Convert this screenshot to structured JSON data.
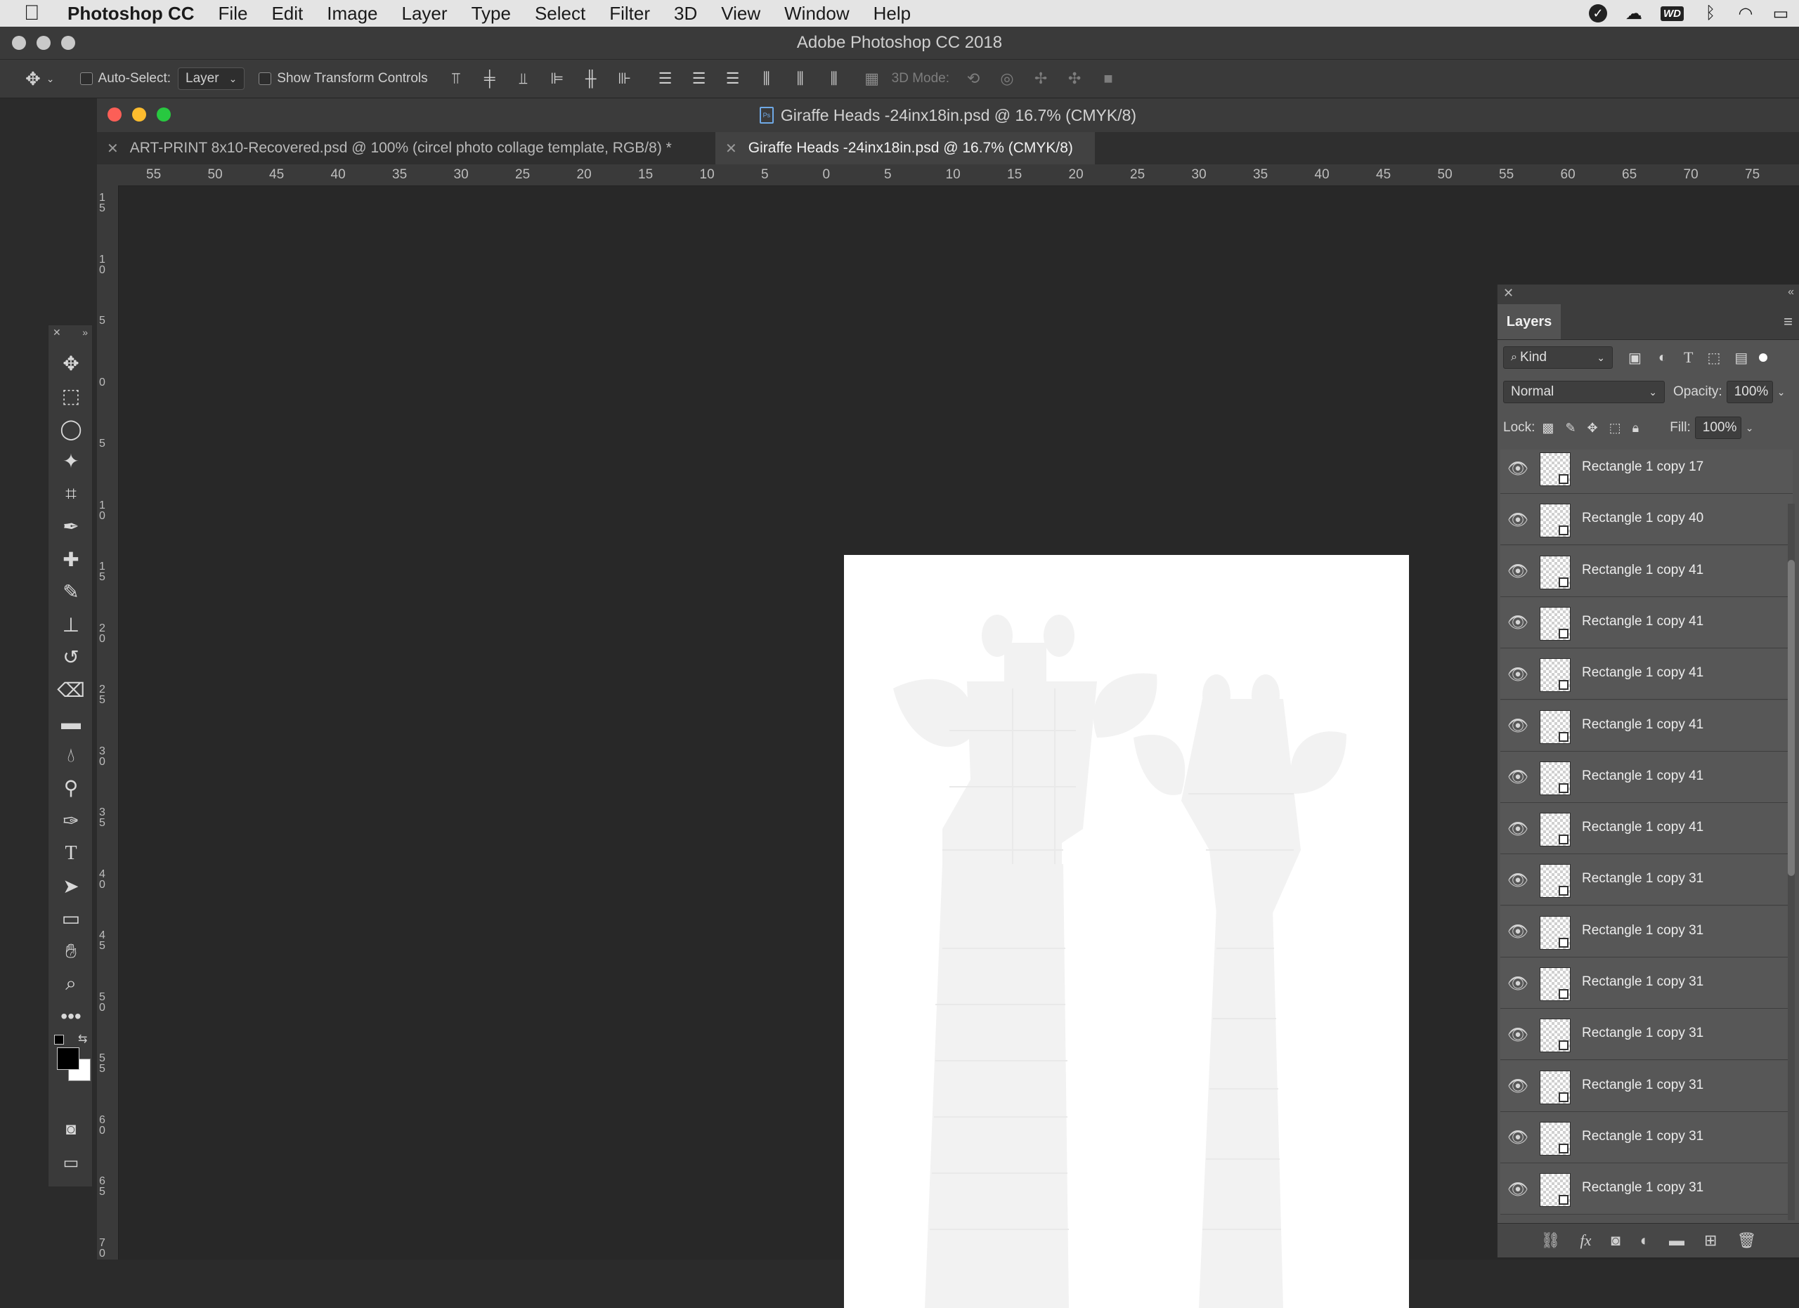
{
  "menubar": {
    "app_name": "Photoshop CC",
    "items": [
      "File",
      "Edit",
      "Image",
      "Layer",
      "Type",
      "Select",
      "Filter",
      "3D",
      "View",
      "Window",
      "Help"
    ],
    "status_icons": [
      "checkmark-icon",
      "creative-cloud-icon",
      "wd-icon",
      "bluetooth-icon",
      "wifi-icon",
      "battery-icon"
    ],
    "wd_label": "WD"
  },
  "app": {
    "title": "Adobe Photoshop CC 2018"
  },
  "options_bar": {
    "auto_select_label": "Auto-Select:",
    "auto_select_value": "Layer",
    "transform_label": "Show Transform Controls",
    "mode_3d_label": "3D Mode:"
  },
  "document": {
    "title": "Giraffe Heads -24inx18in.psd @ 16.7% (CMYK/8)",
    "tabs": [
      {
        "label": "ART-PRINT 8x10-Recovered.psd @ 100% (circel photo collage template, RGB/8) *",
        "active": false
      },
      {
        "label": "Giraffe Heads -24inx18in.psd @ 16.7% (CMYK/8)",
        "active": true
      }
    ],
    "ruler_top": [
      "55",
      "50",
      "45",
      "40",
      "35",
      "30",
      "25",
      "20",
      "15",
      "10",
      "5",
      "0",
      "5",
      "10",
      "15",
      "20",
      "25",
      "30",
      "35",
      "40",
      "45",
      "50",
      "55",
      "60",
      "65",
      "70",
      "75"
    ],
    "ruler_left": [
      "15",
      "10",
      "5",
      "0",
      "5",
      "10",
      "15",
      "20",
      "25",
      "30",
      "35",
      "40",
      "45",
      "50",
      "55",
      "60",
      "65",
      "70"
    ]
  },
  "tools": [
    "move-tool",
    "marquee-tool",
    "lasso-tool",
    "magic-wand-tool",
    "crop-tool",
    "eyedropper-tool",
    "healing-brush-tool",
    "brush-tool",
    "clone-stamp-tool",
    "history-brush-tool",
    "eraser-tool",
    "gradient-tool",
    "blur-tool",
    "dodge-tool",
    "pen-tool",
    "type-tool",
    "path-selection-tool",
    "rectangle-tool",
    "hand-tool",
    "zoom-tool",
    "more-tools"
  ],
  "layers_panel": {
    "title": "Layers",
    "filter_kind": "Kind",
    "blend_mode": "Normal",
    "opacity_label": "Opacity:",
    "opacity_value": "100%",
    "lock_label": "Lock:",
    "fill_label": "Fill:",
    "fill_value": "100%",
    "layers": [
      "Rectangle 1 copy 17",
      "Rectangle 1 copy 40",
      "Rectangle 1 copy 41",
      "Rectangle 1 copy 41",
      "Rectangle 1 copy 41",
      "Rectangle 1 copy 41",
      "Rectangle 1 copy 41",
      "Rectangle 1 copy 41",
      "Rectangle 1 copy 31",
      "Rectangle 1 copy 31",
      "Rectangle 1 copy 31",
      "Rectangle 1 copy 31",
      "Rectangle 1 copy 31",
      "Rectangle 1 copy 31",
      "Rectangle 1 copy 31"
    ]
  },
  "colors": {
    "artboard": "#ffffff",
    "silhouette": "#f2f2f2",
    "canvas_bg": "#282828"
  }
}
